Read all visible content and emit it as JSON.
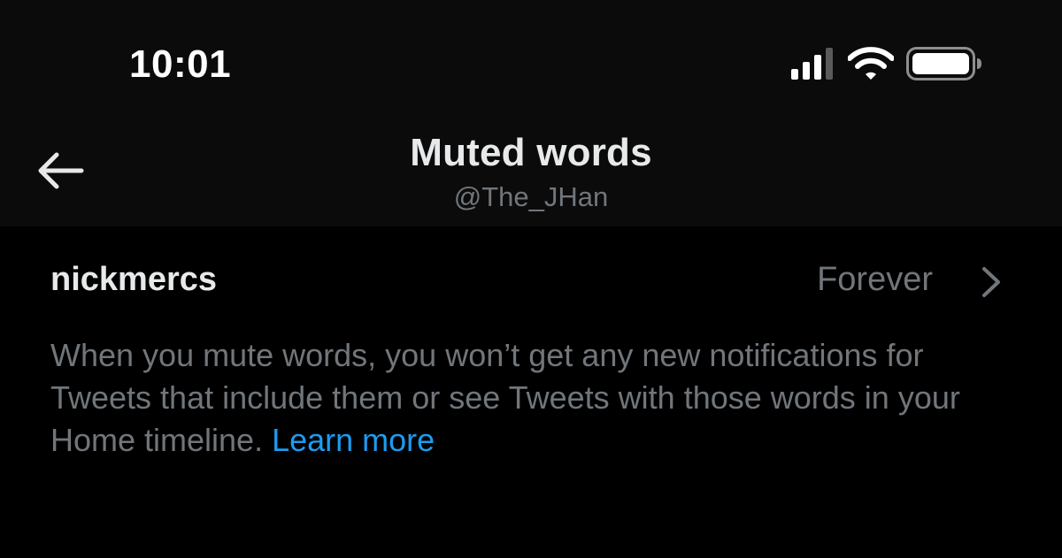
{
  "status_bar": {
    "time": "10:01",
    "icons": [
      "cellular-signal-icon",
      "wifi-icon",
      "battery-icon"
    ]
  },
  "nav": {
    "back_icon": "arrow-left-icon",
    "title": "Muted words",
    "subtitle": "@The_JHan"
  },
  "muted_words": [
    {
      "word": "nickmercs",
      "duration": "Forever"
    }
  ],
  "description": {
    "text": "When you mute words, you won’t get any new notifications for Tweets that include them or see Tweets with those words in your Home timeline.",
    "link_label": "Learn more"
  },
  "colors": {
    "background": "#000000",
    "header_background": "#0b0b0b",
    "primary_text": "#e7e9ea",
    "secondary_text": "#71767b",
    "link": "#1d9bf0"
  }
}
